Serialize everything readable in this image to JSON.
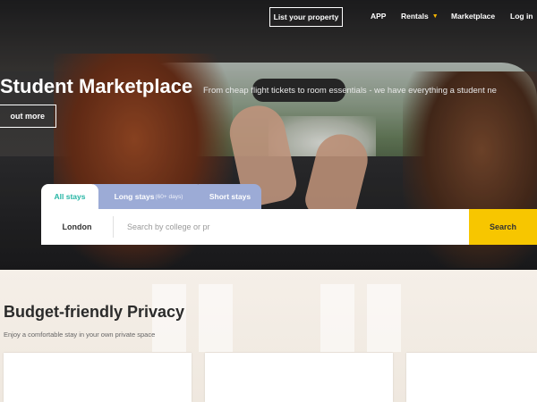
{
  "nav": {
    "list_property": "List your property",
    "app": "APP",
    "rentals": "Rentals",
    "marketplace": "Marketplace",
    "login": "Log in"
  },
  "hero": {
    "title": "Student Marketplace",
    "subtitle": "From cheap flight tickets to room essentials - we have everything a student ne",
    "find_out_more": "out more"
  },
  "search": {
    "tabs": {
      "all": "All stays",
      "long": "Long stays",
      "long_note": "(60+ days)",
      "short": "Short stays"
    },
    "city": "London",
    "placeholder": "Search by college or pr",
    "button": "Search"
  },
  "section": {
    "title": "Budget-friendly Privacy",
    "subtitle": "Enjoy a comfortable stay in your own private space"
  },
  "colors": {
    "accent_teal": "#27b6a5",
    "tab_lavender": "#9cabd6",
    "search_yellow": "#f7c600",
    "caret_yellow": "#f5b400"
  }
}
